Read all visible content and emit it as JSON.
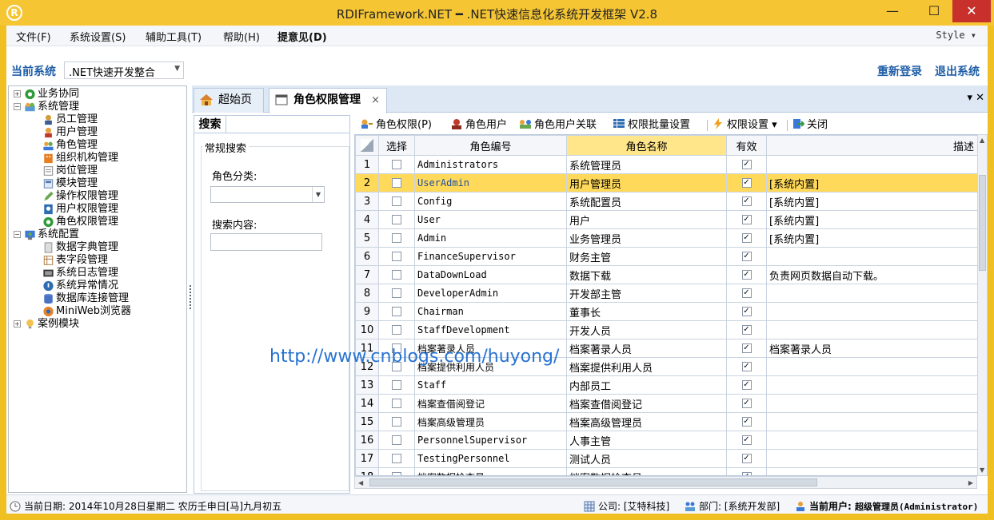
{
  "window": {
    "logo": "R",
    "title": "RDIFramework.NET ━ .NET快速信息化系统开发框架 V2.8",
    "minimize": "—",
    "maximize": "☐",
    "close": "✕"
  },
  "menu": {
    "items": [
      "文件(F)",
      "系统设置(S)",
      "辅助工具(T)",
      "帮助(H)",
      "提意见(D)"
    ],
    "style_label": "Style ▾"
  },
  "sysbar": {
    "label": "当前系统",
    "selected": ".NET快速开发整合",
    "relogin": "重新登录",
    "exit": "退出系统"
  },
  "tree": {
    "nodes": [
      {
        "label": "业务协同",
        "level": 0,
        "expander": "+"
      },
      {
        "label": "系统管理",
        "level": 0,
        "expander": "−"
      },
      {
        "label": "员工管理",
        "level": 1
      },
      {
        "label": "用户管理",
        "level": 1
      },
      {
        "label": "角色管理",
        "level": 1
      },
      {
        "label": "组织机构管理",
        "level": 1
      },
      {
        "label": "岗位管理",
        "level": 1
      },
      {
        "label": "模块管理",
        "level": 1
      },
      {
        "label": "操作权限管理",
        "level": 1
      },
      {
        "label": "用户权限管理",
        "level": 1
      },
      {
        "label": "角色权限管理",
        "level": 1
      },
      {
        "label": "系统配置",
        "level": 0,
        "expander": "−"
      },
      {
        "label": "数据字典管理",
        "level": 1
      },
      {
        "label": "表字段管理",
        "level": 1
      },
      {
        "label": "系统日志管理",
        "level": 1
      },
      {
        "label": "系统异常情况",
        "level": 1
      },
      {
        "label": "数据库连接管理",
        "level": 1
      },
      {
        "label": "MiniWeb浏览器",
        "level": 1
      },
      {
        "label": "案例模块",
        "level": 0,
        "expander": "+"
      }
    ]
  },
  "tabs": {
    "home": "超始页",
    "active": "角色权限管理",
    "close": "×",
    "controls": "▾ ✕"
  },
  "search": {
    "tab": "搜索",
    "group": "常规搜索",
    "category_label": "角色分类:",
    "category_value": "",
    "keyword_label": "搜索内容:",
    "keyword_value": ""
  },
  "toolbar": {
    "role_permission": "角色权限(P)",
    "role_user": "角色用户",
    "role_user_link": "角色用户关联",
    "batch": "权限批量设置",
    "settings": "权限设置 ▾",
    "close": "关闭"
  },
  "grid": {
    "headers": [
      "",
      "选择",
      "角色编号",
      "角色名称",
      "有效",
      "描述"
    ],
    "rows": [
      {
        "n": "1",
        "code": "Administrators",
        "name": "系统管理员",
        "valid": "✓",
        "desc": ""
      },
      {
        "n": "2",
        "code": "UserAdmin",
        "name": "用户管理员",
        "valid": "✓",
        "desc": "[系统内置]"
      },
      {
        "n": "3",
        "code": "Config",
        "name": "系统配置员",
        "valid": "✓",
        "desc": "[系统内置]"
      },
      {
        "n": "4",
        "code": "User",
        "name": "用户",
        "valid": "✓",
        "desc": "[系统内置]"
      },
      {
        "n": "5",
        "code": "Admin",
        "name": "业务管理员",
        "valid": "✓",
        "desc": "[系统内置]"
      },
      {
        "n": "6",
        "code": "FinanceSupervisor",
        "name": "财务主管",
        "valid": "✓",
        "desc": ""
      },
      {
        "n": "7",
        "code": "DataDownLoad",
        "name": "数据下载",
        "valid": "✓",
        "desc": "负责网页数据自动下载。"
      },
      {
        "n": "8",
        "code": "DeveloperAdmin",
        "name": "开发部主管",
        "valid": "✓",
        "desc": ""
      },
      {
        "n": "9",
        "code": "Chairman",
        "name": "董事长",
        "valid": "✓",
        "desc": ""
      },
      {
        "n": "10",
        "code": "StaffDevelopment",
        "name": "开发人员",
        "valid": "✓",
        "desc": ""
      },
      {
        "n": "11",
        "code": "档案著录人员",
        "name": "档案著录人员",
        "valid": "✓",
        "desc": "档案著录人员"
      },
      {
        "n": "12",
        "code": "档案提供利用人员",
        "name": "档案提供利用人员",
        "valid": "✓",
        "desc": ""
      },
      {
        "n": "13",
        "code": "Staff",
        "name": "内部员工",
        "valid": "✓",
        "desc": ""
      },
      {
        "n": "14",
        "code": "档案查借阅登记",
        "name": "档案查借阅登记",
        "valid": "✓",
        "desc": ""
      },
      {
        "n": "15",
        "code": "档案高级管理员",
        "name": "档案高级管理员",
        "valid": "✓",
        "desc": ""
      },
      {
        "n": "16",
        "code": "PersonnelSupervisor",
        "name": "人事主管",
        "valid": "✓",
        "desc": ""
      },
      {
        "n": "17",
        "code": "TestingPersonnel",
        "name": "测试人员",
        "valid": "✓",
        "desc": ""
      },
      {
        "n": "18",
        "code": "档案数据检查员",
        "name": "档案数据检查员",
        "valid": "✓",
        "desc": ""
      }
    ],
    "selected_row": 1
  },
  "watermark": "http://www.cnblogs.com/huyong/",
  "status": {
    "date": "当前日期: 2014年10月28日星期二 农历壬申日[马]九月初五",
    "company": "公司: [艾特科技]",
    "dept": "部门: [系统开发部]",
    "user_label": "当前用户:",
    "user_value": "超级管理员(Administrator)"
  },
  "colors": {
    "frame": "#f0c022",
    "accent_text": "#1f5ea8",
    "selected_row": "#ffd95a",
    "close_button": "#c7302b"
  }
}
